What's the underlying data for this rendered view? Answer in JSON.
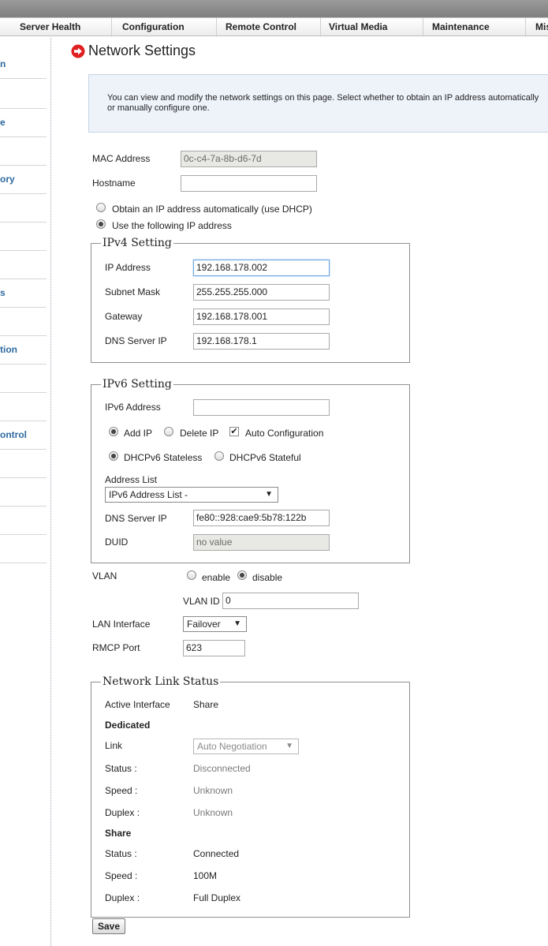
{
  "menu": [
    "Server Health",
    "Configuration",
    "Remote Control",
    "Virtual Media",
    "Maintenance",
    "Mis"
  ],
  "sidebar": [
    "n",
    "",
    "e",
    "",
    "ory",
    "",
    "",
    "",
    "s",
    "",
    "tion",
    "",
    "",
    "ontrol",
    "",
    "",
    "",
    ""
  ],
  "page": {
    "title": "Network Settings",
    "description": "You can view and modify the network settings on this page. Select whether to obtain an IP address automatically or manually configure one."
  },
  "general": {
    "mac_label": "MAC Address",
    "mac_value": "0c-c4-7a-8b-d6-7d",
    "hostname_label": "Hostname",
    "hostname_value": "",
    "dhcp_option": "Obtain an IP address automatically (use DHCP)",
    "static_option": "Use the following IP address"
  },
  "ipv4": {
    "legend": "IPv4 Setting",
    "ip_label": "IP Address",
    "ip_value": "192.168.178.002",
    "subnet_label": "Subnet Mask",
    "subnet_value": "255.255.255.000",
    "gateway_label": "Gateway",
    "gateway_value": "192.168.178.001",
    "dns_label": "DNS Server IP",
    "dns_value": "192.168.178.1"
  },
  "ipv6": {
    "legend": "IPv6 Setting",
    "addr_label": "IPv6 Address",
    "addr_value": "",
    "add_ip": "Add IP",
    "delete_ip": "Delete IP",
    "auto_config": "Auto Configuration",
    "stateless": "DHCPv6 Stateless",
    "stateful": "DHCPv6 Stateful",
    "list_label": "Address List",
    "list_value": "IPv6 Address List -",
    "dns_label": "DNS Server IP",
    "dns_value": "fe80::928:cae9:5b78:122b",
    "duid_label": "DUID",
    "duid_value": "no value"
  },
  "vlan": {
    "label": "VLAN",
    "enable": "enable",
    "disable": "disable",
    "id_label": "VLAN ID",
    "id_value": "0"
  },
  "lan": {
    "label": "LAN Interface",
    "value": "Failover"
  },
  "rmcp": {
    "label": "RMCP Port",
    "value": "623"
  },
  "link": {
    "legend": "Network Link Status",
    "active_label": "Active Interface",
    "active_value": "Share",
    "dedicated_heading": "Dedicated",
    "ded_link_label": "Link",
    "ded_link_value": "Auto Negotiation",
    "ded_status_label": "Status :",
    "ded_status_value": "Disconnected",
    "ded_speed_label": "Speed :",
    "ded_speed_value": "Unknown",
    "ded_duplex_label": "Duplex :",
    "ded_duplex_value": "Unknown",
    "share_heading": "Share",
    "share_status_label": "Status :",
    "share_status_value": "Connected",
    "share_speed_label": "Speed :",
    "share_speed_value": "100M",
    "share_duplex_label": "Duplex :",
    "share_duplex_value": "Full Duplex"
  },
  "save_label": "Save",
  "colors": {
    "accent": "#2f6aa0",
    "title_icon": "#e02020",
    "info_bg": "#eef3fa"
  }
}
